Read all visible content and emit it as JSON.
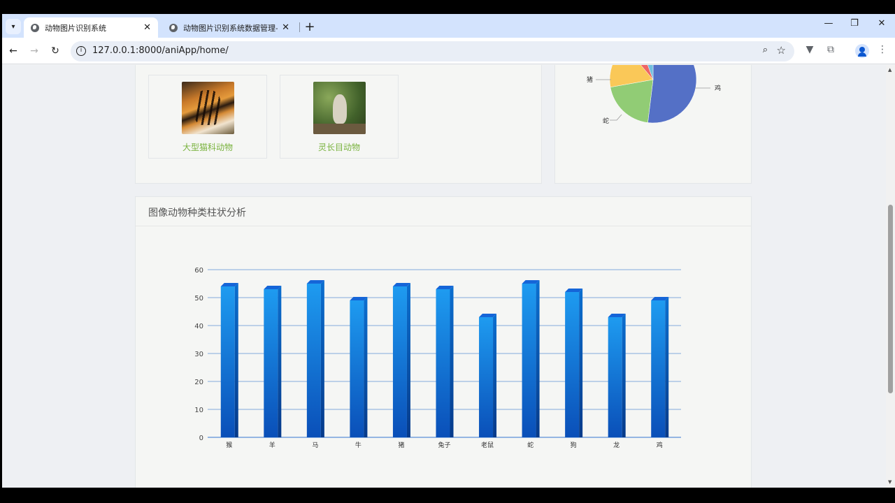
{
  "browser": {
    "tabs": [
      {
        "title": "动物图片识别系统",
        "active": true
      },
      {
        "title": "动物图片识别系统数据管理-登录",
        "active": false
      }
    ],
    "url": "127.0.0.1:8000/aniApp/home/"
  },
  "categories_panel": {
    "cards": [
      {
        "label": "大型猫科动物",
        "image": "tiger"
      },
      {
        "label": "灵长目动物",
        "image": "monkey"
      }
    ]
  },
  "pie_panel": {
    "visible_labels": [
      "猪",
      "蛇",
      "鸡"
    ]
  },
  "bar_panel": {
    "title": "图像动物种类柱状分析"
  },
  "colors": {
    "bar_top": "#1e9bf0",
    "bar_bottom": "#0a4fb8",
    "link_green": "#7ab33f",
    "grid": "#5b8fd6"
  },
  "chart_data": [
    {
      "type": "bar",
      "title": "",
      "xlabel": "",
      "ylabel": "",
      "categories": [
        "猴",
        "羊",
        "马",
        "牛",
        "猪",
        "兔子",
        "老鼠",
        "蛇",
        "狗",
        "龙",
        "鸡"
      ],
      "values": [
        54,
        53,
        55,
        49,
        54,
        53,
        43,
        55,
        52,
        43,
        49
      ],
      "ylim": [
        0,
        60
      ],
      "yticks": [
        0,
        10,
        20,
        30,
        40,
        50,
        60
      ],
      "grid": true
    },
    {
      "type": "pie",
      "labels": [
        "鸡",
        "蛇",
        "猪"
      ],
      "values": [
        42,
        18,
        15
      ],
      "note_partial": true
    }
  ]
}
